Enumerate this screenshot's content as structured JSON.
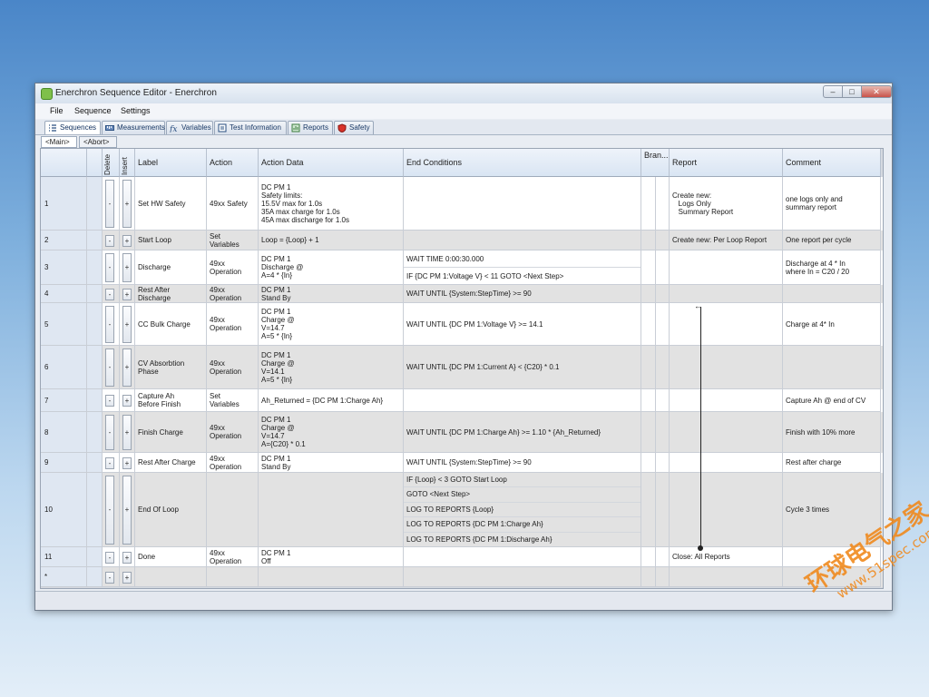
{
  "window": {
    "title": "Enerchron Sequence Editor - Enerchron"
  },
  "menu": [
    "File",
    "Sequence",
    "Settings"
  ],
  "tabs": [
    {
      "label": "Sequences",
      "icon": "list-icon",
      "active": true
    },
    {
      "label": "Measurements",
      "icon": "ruler-icon",
      "active": false
    },
    {
      "label": "Variables",
      "icon": "function-icon",
      "active": false
    },
    {
      "label": "Test Information",
      "icon": "info-icon",
      "active": false
    },
    {
      "label": "Reports",
      "icon": "report-icon",
      "active": false
    },
    {
      "label": "Safety",
      "icon": "shield-icon",
      "active": false
    }
  ],
  "subtabs": [
    "<Main>",
    "<Abort>"
  ],
  "columns": {
    "delete": "Delete",
    "insert": "Insert",
    "label": "Label",
    "action": "Action",
    "action_data": "Action Data",
    "end_conditions": "End Conditions",
    "branch": "Bran...",
    "report": "Report",
    "comment": "Comment"
  },
  "delete_symbol": "-",
  "insert_symbol": "+",
  "rows": [
    {
      "num": "1",
      "label": "Set HW Safety",
      "action": "49xx Safety",
      "action_data": "DC PM 1\nSafety limits:\n15.5V max for 1.0s\n35A max charge for 1.0s\n45A max discharge for 1.0s",
      "end": [
        ""
      ],
      "report": "Create new:\n   Logs Only\n   Summary Report",
      "comment": "one logs only and\nsummary report"
    },
    {
      "num": "2",
      "label": "Start Loop",
      "action": "Set\nVariables",
      "action_data": "Loop = {Loop} + 1",
      "end": [
        ""
      ],
      "report": "Create new: Per Loop Report",
      "comment": "One report per cycle"
    },
    {
      "num": "3",
      "label": "Discharge",
      "action": "49xx\nOperation",
      "action_data": "DC PM 1\nDischarge @\nA=4 * {In}",
      "end": [
        "WAIT TIME 0:00:30.000",
        "IF {DC PM 1:Voltage V} < 11 GOTO <Next Step>"
      ],
      "report": "",
      "comment": "Discharge at 4 * In\nwhere In = C20 / 20"
    },
    {
      "num": "4",
      "label": "Rest After\nDischarge",
      "action": "49xx\nOperation",
      "action_data": "DC PM 1\nStand By",
      "end": [
        "WAIT UNTIL {System:StepTime} >= 90"
      ],
      "report": "",
      "comment": ""
    },
    {
      "num": "5",
      "label": "CC Bulk Charge",
      "action": "49xx\nOperation",
      "action_data": "DC PM 1\nCharge @\nV=14.7\nA=5 * {In}",
      "end": [
        "WAIT UNTIL {DC PM 1:Voltage V} >= 14.1"
      ],
      "report": "",
      "comment": "Charge at 4* In"
    },
    {
      "num": "6",
      "label": "CV Absorbtion\nPhase",
      "action": "49xx\nOperation",
      "action_data": "DC PM 1\nCharge @\nV=14.1\nA=5 * {In}",
      "end": [
        "WAIT UNTIL {DC PM 1:Current A} < {C20} * 0.1"
      ],
      "report": "",
      "comment": ""
    },
    {
      "num": "7",
      "label": "Capture Ah\nBefore Finish",
      "action": "Set\nVariables",
      "action_data": "Ah_Returned = {DC PM 1:Charge Ah}",
      "end": [
        ""
      ],
      "report": "",
      "comment": "Capture Ah @ end of CV"
    },
    {
      "num": "8",
      "label": "Finish Charge",
      "action": "49xx\nOperation",
      "action_data": "DC PM 1\nCharge @\nV=14.7\nA={C20} * 0.1",
      "end": [
        "WAIT UNTIL {DC PM 1:Charge Ah} >= 1.10 * {Ah_Returned}"
      ],
      "report": "",
      "comment": "Finish with 10% more"
    },
    {
      "num": "9",
      "label": "Rest After Charge",
      "action": "49xx\nOperation",
      "action_data": "DC PM 1\nStand By",
      "end": [
        "WAIT UNTIL {System:StepTime} >= 90"
      ],
      "report": "",
      "comment": "Rest after charge"
    },
    {
      "num": "10",
      "label": "End Of Loop",
      "action": "",
      "action_data": "",
      "end": [
        "IF {Loop} < 3 GOTO Start Loop",
        "GOTO <Next Step>",
        "LOG TO REPORTS {Loop}",
        "LOG TO REPORTS {DC PM 1:Charge Ah}",
        "LOG TO REPORTS {DC PM 1:Discharge Ah}"
      ],
      "report": "",
      "comment": "Cycle 3 times"
    },
    {
      "num": "11",
      "label": "Done",
      "action": "49xx\nOperation",
      "action_data": "DC PM 1\nOff",
      "end": [
        ""
      ],
      "report": "Close: All Reports",
      "comment": ""
    },
    {
      "num": "*",
      "label": "",
      "action": "",
      "action_data": "",
      "end": [
        ""
      ],
      "report": "",
      "comment": ""
    }
  ],
  "branch_arrow": "←",
  "watermark": {
    "main": "环球电气之家",
    "sub": "www.51spec.com"
  },
  "colors": {
    "row_shaded": "#e2e2e2",
    "row_white": "#ffffff",
    "header": "#dde8f5",
    "accent": "#2a6ebb"
  }
}
